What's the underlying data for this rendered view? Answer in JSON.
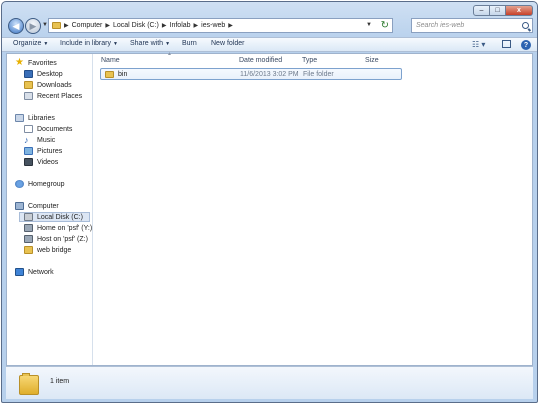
{
  "window": {
    "buttons": {
      "minimize": "–",
      "maximize": "□",
      "close": "x"
    }
  },
  "address_bar": {
    "breadcrumbs": [
      "Computer",
      "Local Disk (C:)",
      "Infolab",
      "ies-web"
    ],
    "search_placeholder": "Search ies-web",
    "refresh_glyph": "↻"
  },
  "command_bar": {
    "organize": "Organize",
    "include": "Include in library",
    "share": "Share with",
    "burn": "Burn",
    "new_folder": "New folder",
    "help": "?"
  },
  "nav_pane": {
    "favorites": "Favorites",
    "desktop": "Desktop",
    "downloads": "Downloads",
    "recent": "Recent Places",
    "libraries": "Libraries",
    "documents": "Documents",
    "music": "Music",
    "pictures": "Pictures",
    "videos": "Videos",
    "homegroup": "Homegroup",
    "computer": "Computer",
    "local_disk": "Local Disk (C:)",
    "home_psf": "Home on 'psf' (Y:)",
    "host_psf": "Host on 'psf' (Z:)",
    "web_bridge": "web bridge",
    "network": "Network"
  },
  "file_list": {
    "columns": {
      "name": "Name",
      "date": "Date modified",
      "type": "Type",
      "size": "Size"
    },
    "rows": [
      {
        "name": "bin",
        "date": "11/6/2013 3:02 PM",
        "type": "File folder",
        "size": ""
      }
    ]
  },
  "details": {
    "count": "1 item"
  }
}
